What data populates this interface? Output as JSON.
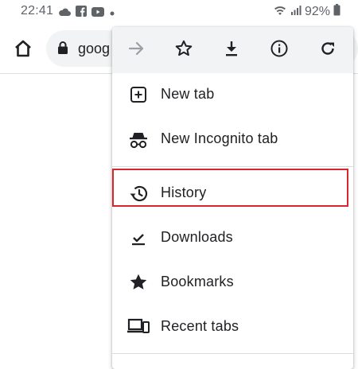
{
  "status_bar": {
    "time": "22:41",
    "left_icons": [
      "cloud-icon",
      "facebook-icon",
      "youtube-icon",
      "dot-icon"
    ],
    "right_icons": [
      "wifi-icon",
      "signal-icon"
    ],
    "battery": "92%"
  },
  "toolbar": {
    "url": "goog",
    "home_icon": "home-icon",
    "lock_icon": "lock-icon"
  },
  "menu": {
    "icon_row": [
      "forward-arrow-icon",
      "star-icon",
      "download-icon",
      "info-icon",
      "refresh-icon"
    ],
    "items": [
      {
        "label": "New tab",
        "icon": "plus-box-icon"
      },
      {
        "label": "New Incognito tab",
        "icon": "incognito-icon"
      },
      {
        "label": "History",
        "icon": "history-icon"
      },
      {
        "label": "Downloads",
        "icon": "download-check-icon"
      },
      {
        "label": "Bookmarks",
        "icon": "star-filled-icon"
      },
      {
        "label": "Recent tabs",
        "icon": "devices-icon"
      }
    ]
  },
  "colors": {
    "highlight": "#d6262e",
    "icon_row_bg": "#f1f3f4",
    "text": "#202124"
  }
}
